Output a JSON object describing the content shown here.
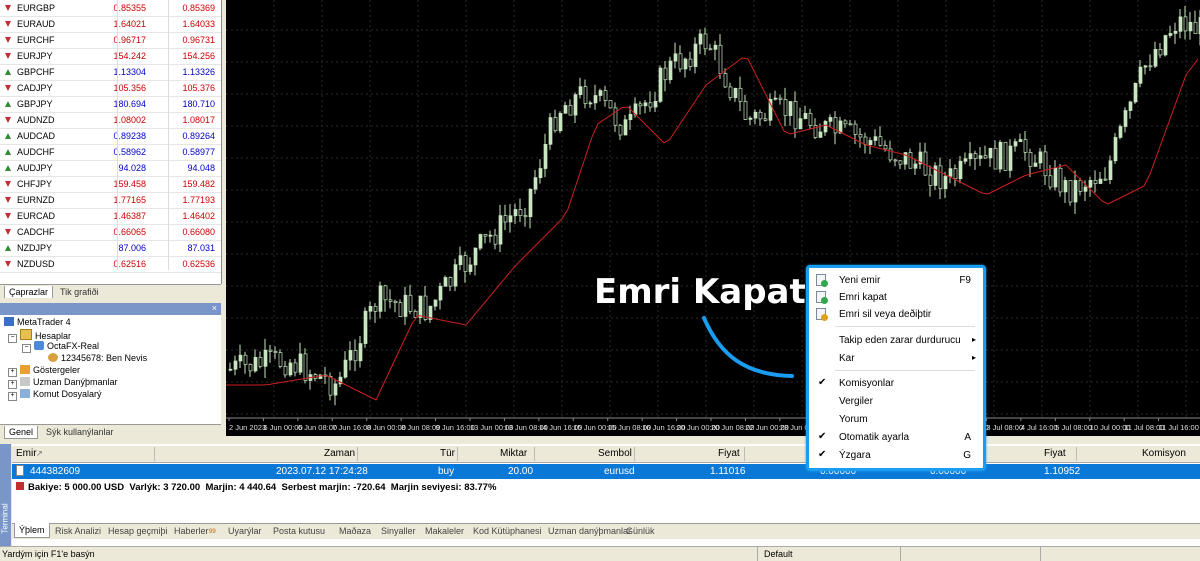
{
  "market_watch": {
    "rows": [
      {
        "symbol": "EURGBP",
        "bid": "0.85355",
        "ask": "0.85369",
        "dir": "dn",
        "color": "red"
      },
      {
        "symbol": "EURAUD",
        "bid": "1.64021",
        "ask": "1.64033",
        "dir": "dn",
        "color": "red"
      },
      {
        "symbol": "EURCHF",
        "bid": "0.96717",
        "ask": "0.96731",
        "dir": "dn",
        "color": "red"
      },
      {
        "symbol": "EURJPY",
        "bid": "154.242",
        "ask": "154.256",
        "dir": "dn",
        "color": "red"
      },
      {
        "symbol": "GBPCHF",
        "bid": "1.13304",
        "ask": "1.13326",
        "dir": "up",
        "color": "blue"
      },
      {
        "symbol": "CADJPY",
        "bid": "105.356",
        "ask": "105.376",
        "dir": "dn",
        "color": "red"
      },
      {
        "symbol": "GBPJPY",
        "bid": "180.694",
        "ask": "180.710",
        "dir": "up",
        "color": "blue"
      },
      {
        "symbol": "AUDNZD",
        "bid": "1.08002",
        "ask": "1.08017",
        "dir": "dn",
        "color": "red"
      },
      {
        "symbol": "AUDCAD",
        "bid": "0.89238",
        "ask": "0.89264",
        "dir": "up",
        "color": "blue"
      },
      {
        "symbol": "AUDCHF",
        "bid": "0.58962",
        "ask": "0.58977",
        "dir": "up",
        "color": "blue"
      },
      {
        "symbol": "AUDJPY",
        "bid": "94.028",
        "ask": "94.048",
        "dir": "up",
        "color": "blue"
      },
      {
        "symbol": "CHFJPY",
        "bid": "159.458",
        "ask": "159.482",
        "dir": "dn",
        "color": "red"
      },
      {
        "symbol": "EURNZD",
        "bid": "1.77165",
        "ask": "1.77193",
        "dir": "dn",
        "color": "red"
      },
      {
        "symbol": "EURCAD",
        "bid": "1.46387",
        "ask": "1.46402",
        "dir": "dn",
        "color": "red"
      },
      {
        "symbol": "CADCHF",
        "bid": "0.66065",
        "ask": "0.66080",
        "dir": "dn",
        "color": "red"
      },
      {
        "symbol": "NZDJPY",
        "bid": "87.006",
        "ask": "87.031",
        "dir": "up",
        "color": "blue"
      },
      {
        "symbol": "NZDUSD",
        "bid": "0.62516",
        "ask": "0.62536",
        "dir": "dn",
        "color": "red"
      }
    ],
    "tabs": [
      "Çaprazlar",
      "Tik grafiði"
    ]
  },
  "navigator": {
    "root": "MetaTrader 4",
    "accounts": "Hesaplar",
    "server": "OctaFX-Real",
    "account": "12345678: Ben Nevis",
    "indicators": "Göstergeler",
    "experts": "Uzman Danýþmanlar",
    "scripts": "Komut Dosyalarý",
    "tabs": [
      "Genel",
      "Sýk kullanýlanlar"
    ]
  },
  "chart": {
    "x_labels": [
      "2 Jun 2023",
      "6 Jun 00:00",
      "6 Jun 08:00",
      "7 Jun 16:00",
      "8 Jun 00:00",
      "8 Jun 08:00",
      "9 Jun 16:00",
      "13 Jun 00:00",
      "13 Jun 08:00",
      "14 Jun 16:00",
      "15 Jun 00:00",
      "15 Jun 08:00",
      "16 Jun 16:00",
      "20 Jun 00:00",
      "20 Jun 08:00",
      "22 Jun 00:00",
      "23 Jun 08:00",
      "26 Jun 16:00",
      "27 Jun 00:00",
      "28 Jun 08:00",
      "29 Jun 16:00",
      "3 Jul 00:00",
      "3 Jul 08:00",
      "4 Jul 16:00",
      "5 Jul 08:00",
      "10 Jul 00:00",
      "11 Jul 08:00",
      "11 Jul 16:00"
    ],
    "bg_color": "#000000",
    "grid_color": "#2a2a2a",
    "bull_color": "#c8e6c0",
    "ma_color": "#cc2020"
  },
  "context_menu": {
    "items": [
      {
        "label": "Yeni emir",
        "shortcut": "F9",
        "icon": "new-order-icon"
      },
      {
        "label": "Emri kapat",
        "shortcut": "",
        "icon": "close-order-icon"
      },
      {
        "label": "Emri sil veya deðiþtir",
        "shortcut": "",
        "icon": "modify-order-icon"
      },
      {
        "label": "Takip eden zarar durdurucu",
        "submenu": true
      },
      {
        "label": "Kar",
        "submenu": true
      },
      {
        "label": "Komisyonlar",
        "checked": true
      },
      {
        "label": "Vergiler",
        "checked": false
      },
      {
        "label": "Yorum",
        "checked": false
      },
      {
        "label": "Otomatik ayarla",
        "shortcut": "A",
        "checked": true
      },
      {
        "label": "Ýzgara",
        "shortcut": "G",
        "checked": true
      }
    ]
  },
  "callout": "Emri Kapat",
  "terminal": {
    "headers": [
      "Emir",
      "Zaman",
      "Tür",
      "Miktar",
      "Sembol",
      "Fiyat",
      "",
      "",
      "Fiyat",
      "Komisyon"
    ],
    "order": {
      "id": "444382609",
      "time": "2023.07.12 17:24:28",
      "type": "buy",
      "size": "20.00",
      "symbol": "eurusd",
      "price": "1.11016",
      "sl": "0.00000",
      "tp": "0.00000",
      "cur_price": "1.10952"
    },
    "balance_text": "Bakiye: 5 000.00 USD  Varlýk: 3 720.00  Marjin: 4 440.64  Serbest marjin: -720.64  Marjin seviyesi: 83.77%",
    "side_label": "Terminal",
    "tabs": [
      "Ýþlem",
      "Risk Analizi",
      "Hesap geçmiþi",
      "Haberler",
      "Uyarýlar",
      "Posta kutusu",
      "Maðaza",
      "Sinyaller",
      "Makaleler",
      "Kod Kütüphanesi",
      "Uzman danýþmanlar",
      "Günlük"
    ],
    "news_badge": "99"
  },
  "status": {
    "help": "Yardým için F1'e basýn",
    "profile": "Default"
  }
}
